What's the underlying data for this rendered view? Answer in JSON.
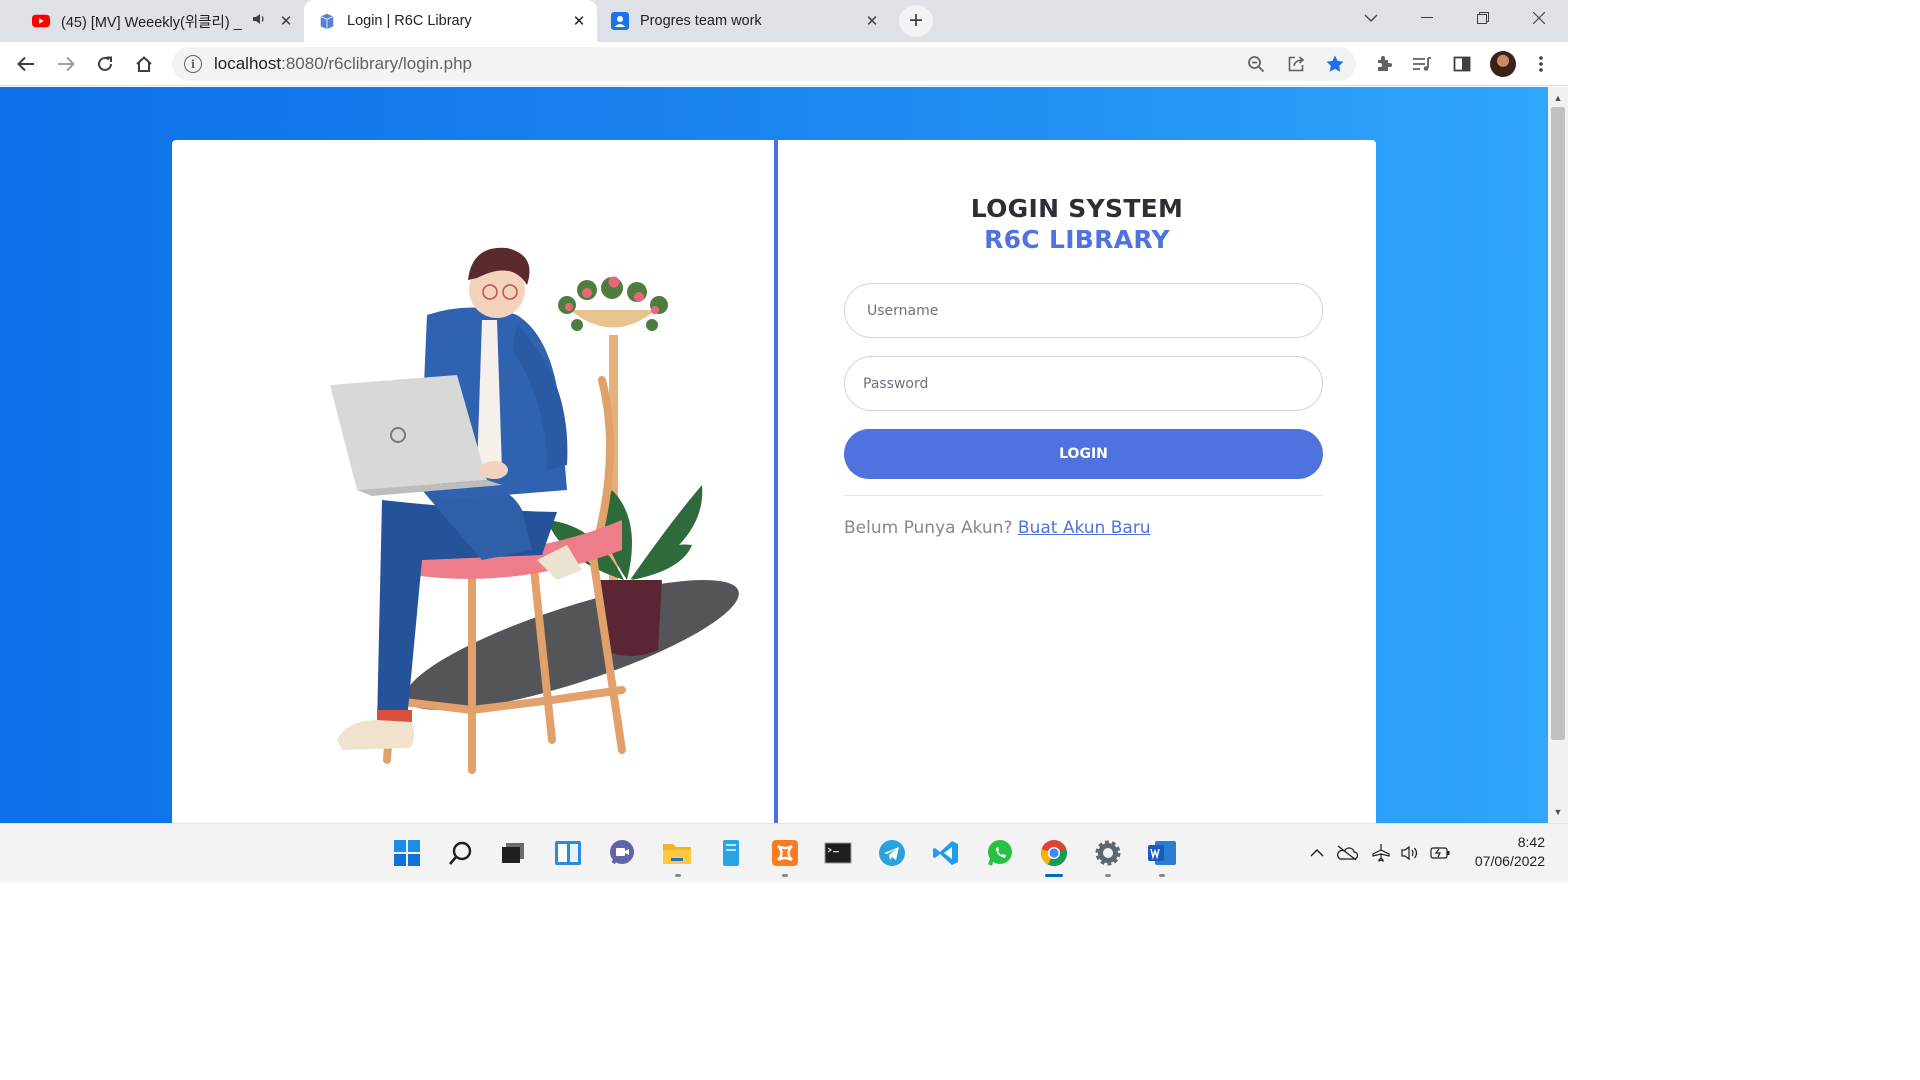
{
  "browser": {
    "tabs": [
      {
        "title": "(45) [MV] Weeekly(위클리) _",
        "icon": "youtube-icon",
        "audio": true,
        "active": false
      },
      {
        "title": "Login | R6C Library",
        "icon": "book-icon",
        "active": true
      },
      {
        "title": "Progres team work",
        "icon": "contacts-icon",
        "active": false
      }
    ],
    "new_tab_label": "+",
    "url": {
      "host": "localhost",
      "path": ":8080/r6clibrary/login.php"
    }
  },
  "login": {
    "title_line1": "LOGIN SYSTEM",
    "title_line2": "R6C LIBRARY",
    "username_placeholder": "Username",
    "password_placeholder": "Password",
    "login_button": "LOGIN",
    "register_prompt": "Belum Punya Akun? ",
    "register_link": "Buat Akun Baru"
  },
  "colors": {
    "primary": "#4e73df",
    "background_gradient": [
      "#0d6fea",
      "#30a6fb"
    ]
  },
  "taskbar": {
    "apps": [
      "start-icon",
      "search-icon",
      "task-view-icon",
      "widgets-icon",
      "chat-icon",
      "file-explorer-icon",
      "notepad-icon",
      "xampp-icon",
      "terminal-icon",
      "telegram-icon",
      "vscode-icon",
      "whatsapp-icon",
      "chrome-icon",
      "settings-icon",
      "word-icon"
    ],
    "clock_time": "8:42",
    "clock_date": "07/06/2022"
  }
}
